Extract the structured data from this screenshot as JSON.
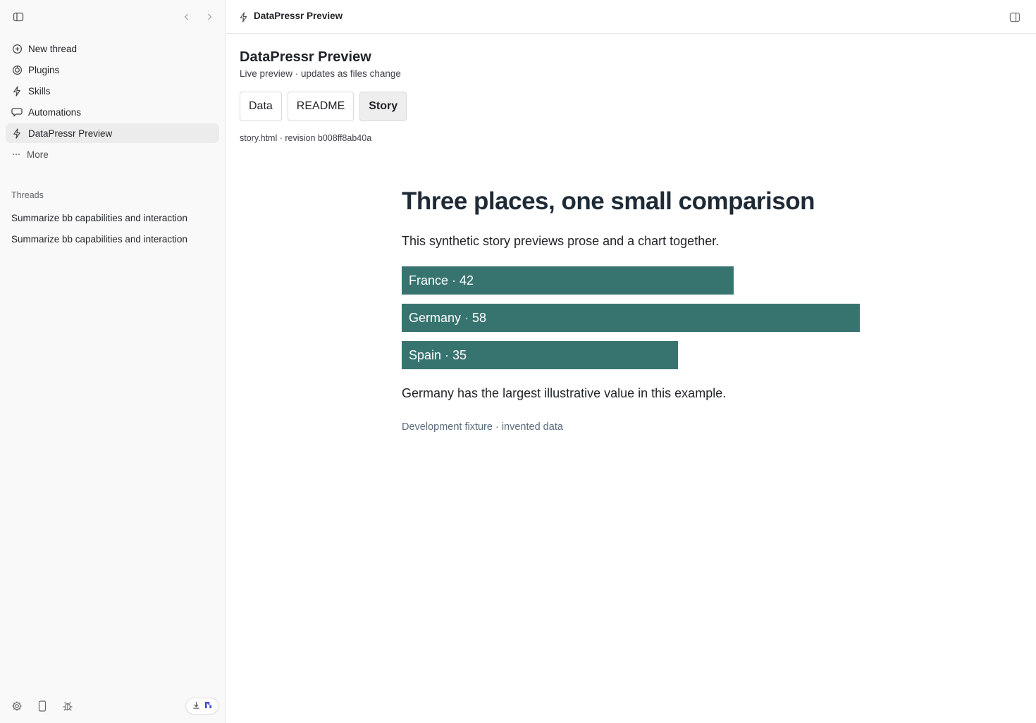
{
  "sidebar": {
    "nav": [
      {
        "label": "New thread",
        "icon": "plus-circle-icon"
      },
      {
        "label": "Plugins",
        "icon": "plugin-icon"
      },
      {
        "label": "Skills",
        "icon": "bolt-icon"
      },
      {
        "label": "Automations",
        "icon": "chat-bubble-icon"
      },
      {
        "label": "DataPressr Preview",
        "icon": "bolt-icon",
        "active": true
      }
    ],
    "more_label": "More",
    "threads_heading": "Threads",
    "threads": [
      {
        "label": "Summarize bb capabilities and interaction"
      },
      {
        "label": "Summarize bb capabilities and interaction"
      }
    ]
  },
  "topbar": {
    "title": "DataPressr Preview"
  },
  "page": {
    "title": "DataPressr Preview",
    "subtitle": "Live preview · updates as files change",
    "tabs": [
      {
        "label": "Data"
      },
      {
        "label": "README"
      },
      {
        "label": "Story",
        "active": true
      }
    ],
    "file_meta": "story.html · revision b008ff8ab40a"
  },
  "story": {
    "heading": "Three places, one small comparison",
    "lede": "This synthetic story previews prose and a chart together.",
    "note": "Germany has the largest illustrative value in this example.",
    "footer": "Development fixture · invented data"
  },
  "chart_data": {
    "type": "bar",
    "orientation": "horizontal",
    "categories": [
      "France",
      "Germany",
      "Spain"
    ],
    "values": [
      42,
      58,
      35
    ],
    "labels": [
      "France · 42",
      "Germany · 58",
      "Spain · 35"
    ],
    "bar_color": "#377470"
  },
  "colors": {
    "accent": "#377470",
    "sidebar_bg": "#f9f9f9"
  }
}
